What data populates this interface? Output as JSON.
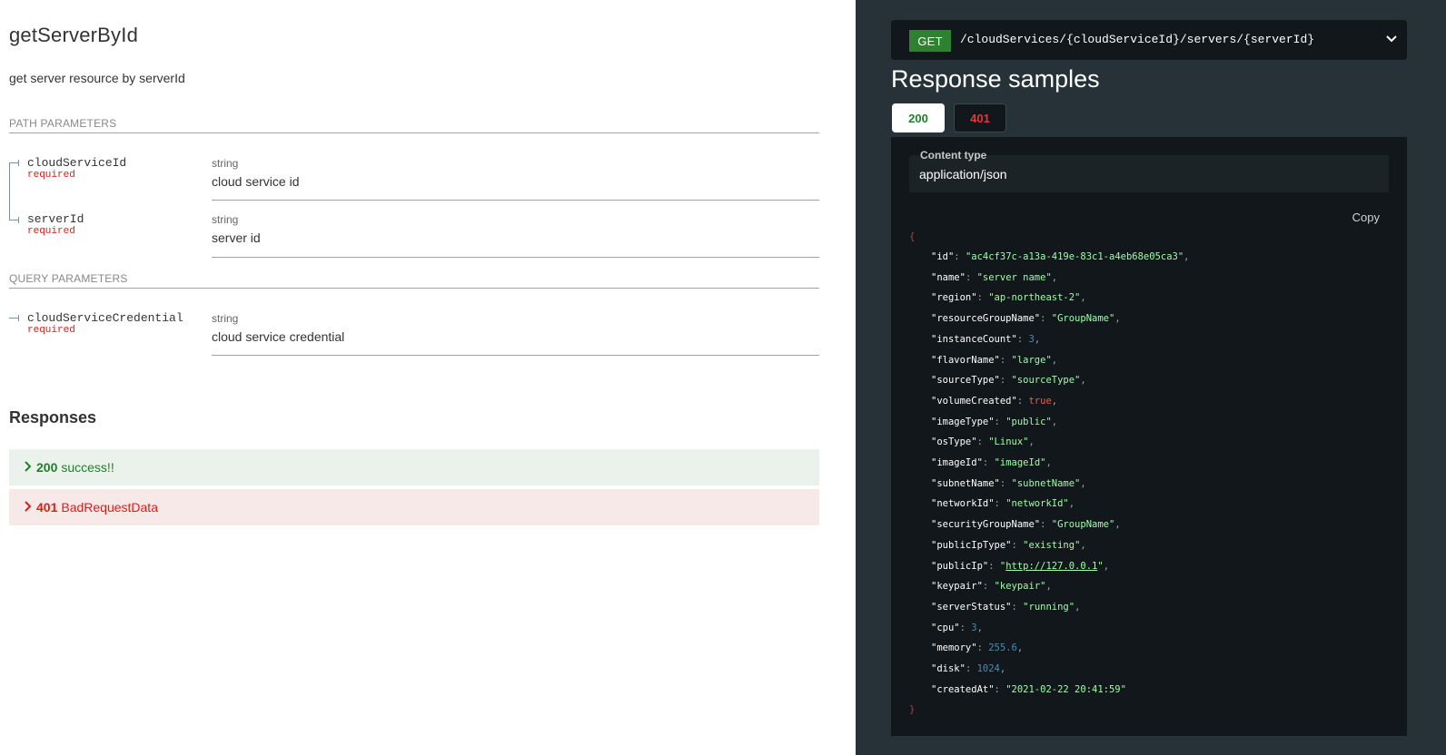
{
  "operation": {
    "title": "getServerById",
    "description": "get server resource by serverId"
  },
  "path_parameters": {
    "heading": "PATH PARAMETERS",
    "items": [
      {
        "name": "cloudServiceId",
        "required": "required",
        "type": "string",
        "description": "cloud service id"
      },
      {
        "name": "serverId",
        "required": "required",
        "type": "string",
        "description": "server id"
      }
    ]
  },
  "query_parameters": {
    "heading": "QUERY PARAMETERS",
    "items": [
      {
        "name": "cloudServiceCredential",
        "required": "required",
        "type": "string",
        "description": "cloud service credential"
      }
    ]
  },
  "responses": {
    "heading": "Responses",
    "items": [
      {
        "code": "200",
        "label": "success!!",
        "status": "success"
      },
      {
        "code": "401",
        "label": "BadRequestData",
        "status": "error"
      }
    ]
  },
  "endpoint": {
    "method": "GET",
    "path": "/cloudServices/{cloudServiceId}/servers/{serverId}"
  },
  "samples": {
    "heading": "Response samples",
    "tabs": [
      {
        "label": "200",
        "active": true
      },
      {
        "label": "401",
        "active": false
      }
    ],
    "content_type_label": "Content type",
    "content_type_value": "application/json",
    "copy_label": "Copy",
    "open_brace": "{",
    "close_brace": "}",
    "json_fields": [
      {
        "key": "\"id\"",
        "value": "\"ac4cf37c-a13a-419e-83c1-a4eb68e05ca3\"",
        "kind": "s"
      },
      {
        "key": "\"name\"",
        "value": "\"server name\"",
        "kind": "s"
      },
      {
        "key": "\"region\"",
        "value": "\"ap-northeast-2\"",
        "kind": "s"
      },
      {
        "key": "\"resourceGroupName\"",
        "value": "\"GroupName\"",
        "kind": "s"
      },
      {
        "key": "\"instanceCount\"",
        "value": "3",
        "kind": "n"
      },
      {
        "key": "\"flavorName\"",
        "value": "\"large\"",
        "kind": "s"
      },
      {
        "key": "\"sourceType\"",
        "value": "\"sourceType\"",
        "kind": "s"
      },
      {
        "key": "\"volumeCreated\"",
        "value": "true",
        "kind": "b"
      },
      {
        "key": "\"imageType\"",
        "value": "\"public\"",
        "kind": "s"
      },
      {
        "key": "\"osType\"",
        "value": "\"Linux\"",
        "kind": "s"
      },
      {
        "key": "\"imageId\"",
        "value": "\"imageId\"",
        "kind": "s"
      },
      {
        "key": "\"subnetName\"",
        "value": "\"subnetName\"",
        "kind": "s"
      },
      {
        "key": "\"networkId\"",
        "value": "\"networkId\"",
        "kind": "s"
      },
      {
        "key": "\"securityGroupName\"",
        "value": "\"GroupName\"",
        "kind": "s"
      },
      {
        "key": "\"publicIpType\"",
        "value": "\"existing\"",
        "kind": "s"
      },
      {
        "key": "\"publicIp\"",
        "value": "http://127.0.0.1",
        "kind": "u"
      },
      {
        "key": "\"keypair\"",
        "value": "\"keypair\"",
        "kind": "s"
      },
      {
        "key": "\"serverStatus\"",
        "value": "\"running\"",
        "kind": "s"
      },
      {
        "key": "\"cpu\"",
        "value": "3",
        "kind": "n"
      },
      {
        "key": "\"memory\"",
        "value": "255.6",
        "kind": "n"
      },
      {
        "key": "\"disk\"",
        "value": "1024",
        "kind": "n"
      },
      {
        "key": "\"createdAt\"",
        "value": "\"2021-02-22 20:41:59\"",
        "kind": "s"
      }
    ]
  },
  "colors": {
    "success": "#1d8127",
    "error": "#d41f1c",
    "dark_panel": "#263238",
    "code_bg": "#11171a",
    "json_string": "#a0fbaa",
    "json_number": "#4a8bb3",
    "json_boolean": "#e95c59"
  }
}
